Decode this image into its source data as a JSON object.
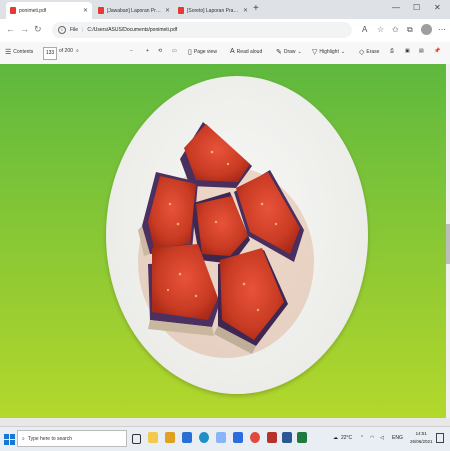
{
  "browser": {
    "tabs": [
      {
        "title": "ponimeti.pdf",
        "active": true
      },
      {
        "title": "[Jawaban] Laporan Praktikum Kim",
        "active": false
      },
      {
        "title": "[Soreto] Laporan Praktikum Ma",
        "active": false
      }
    ],
    "address": {
      "prefix": "File",
      "url": "C:/Users/ASUS/Documents/ponimeti.pdf"
    }
  },
  "pdf_toolbar": {
    "contents_label": "Contents",
    "page_number": "133",
    "page_total": "of 200",
    "page_view_label": "Page view",
    "read_aloud_label": "Read aloud",
    "draw_label": "Draw",
    "highlight_label": "Highlight",
    "erase_label": "Erase"
  },
  "taskbar": {
    "search_placeholder": "Type here to search",
    "weather": "22°C",
    "language": "ENG",
    "time": "14:51",
    "date": "26/06/2021"
  },
  "colors": {
    "page_bg": "#8bc635",
    "tab_bar": "#dee1e6",
    "taskbar": "#e9eef4",
    "pdf_red": "#e53935"
  }
}
